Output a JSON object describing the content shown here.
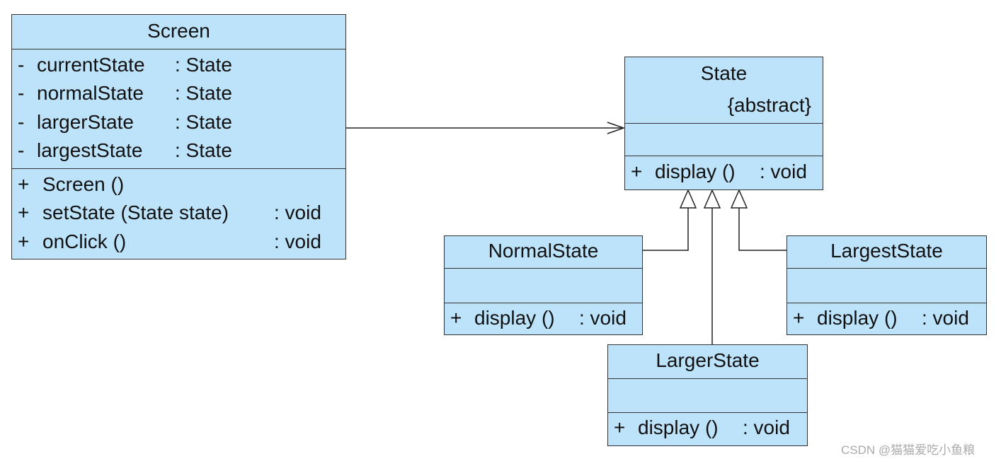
{
  "classes": {
    "screen": {
      "name": "Screen",
      "attributes": [
        {
          "vis": "-",
          "name": "currentState",
          "type": ": State"
        },
        {
          "vis": "-",
          "name": "normalState",
          "type": ": State"
        },
        {
          "vis": "-",
          "name": "largerState",
          "type": ": State"
        },
        {
          "vis": "-",
          "name": "largestState",
          "type": ": State"
        }
      ],
      "methods": [
        {
          "vis": "+",
          "name": "Screen ()",
          "type": ""
        },
        {
          "vis": "+",
          "name": "setState (State state)",
          "type": ": void"
        },
        {
          "vis": "+",
          "name": "onClick ()",
          "type": ": void"
        }
      ]
    },
    "state": {
      "name": "State",
      "stereotype": "{abstract}",
      "method": {
        "vis": "+",
        "name": "display ()",
        "type": ": void"
      }
    },
    "normal": {
      "name": "NormalState",
      "method": {
        "vis": "+",
        "name": "display ()",
        "type": ": void"
      }
    },
    "largest": {
      "name": "LargestState",
      "method": {
        "vis": "+",
        "name": "display ()",
        "type": ": void"
      }
    },
    "larger": {
      "name": "LargerState",
      "method": {
        "vis": "+",
        "name": "display ()",
        "type": ": void"
      }
    }
  },
  "relations": [
    {
      "type": "association",
      "from": "Screen",
      "to": "State"
    },
    {
      "type": "generalization",
      "from": "NormalState",
      "to": "State"
    },
    {
      "type": "generalization",
      "from": "LargerState",
      "to": "State"
    },
    {
      "type": "generalization",
      "from": "LargestState",
      "to": "State"
    }
  ],
  "colors": {
    "class_fill": "#bde3fb",
    "border": "#333333"
  },
  "watermark": "CSDN @猫猫爱吃小鱼粮"
}
